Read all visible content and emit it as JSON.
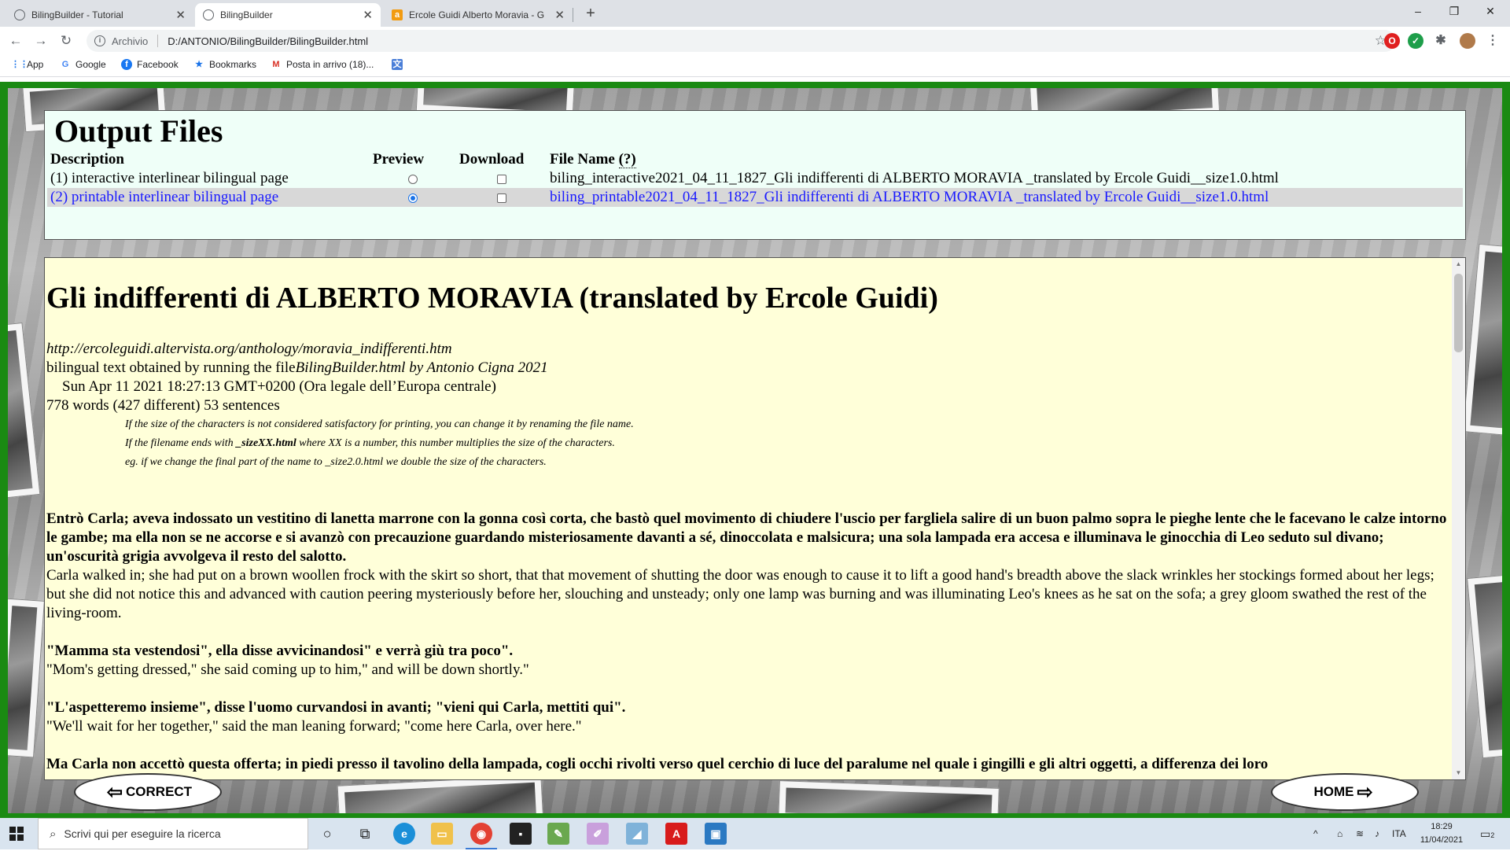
{
  "browser": {
    "tabs": [
      {
        "title": "BilingBuilder - Tutorial",
        "icon": "globe-icon",
        "active": false
      },
      {
        "title": "BilingBuilder",
        "icon": "globe-icon",
        "active": true
      },
      {
        "title": "Ercole Guidi Alberto Moravia - G",
        "icon": "amazon-icon",
        "active": false
      }
    ],
    "new_tab": "+",
    "window_controls": {
      "minimize": "–",
      "restore": "❐",
      "close": "✕"
    },
    "address": {
      "site_label": "Archivio",
      "url": "D:/ANTONIO/BilingBuilder/BilingBuilder.html"
    },
    "bookmarks": [
      {
        "label": "App",
        "icon": "apps-grid-icon"
      },
      {
        "label": "Google",
        "icon": "google-icon"
      },
      {
        "label": "Facebook",
        "icon": "facebook-icon"
      },
      {
        "label": "Bookmarks",
        "icon": "star-icon"
      },
      {
        "label": "Posta in arrivo (18)...",
        "icon": "gmail-icon"
      },
      {
        "label": "",
        "icon": "translate-icon"
      }
    ]
  },
  "output_files": {
    "title": "Output Files",
    "headers": {
      "description": "Description",
      "preview": "Preview",
      "download": "Download",
      "file_name": "File Name",
      "help": "(?)"
    },
    "rows": [
      {
        "description": "(1) interactive interlinear bilingual page",
        "preview": false,
        "download": false,
        "file_name": "biling_interactive2021_04_11_1827_Gli indifferenti di ALBERTO MORAVIA _translated by Ercole Guidi__size1.0.html"
      },
      {
        "description": "(2) printable interlinear bilingual page",
        "preview": true,
        "download": false,
        "file_name": "biling_printable2021_04_11_1827_Gli indifferenti di ALBERTO MORAVIA _translated by Ercole Guidi__size1.0.html"
      }
    ]
  },
  "document": {
    "title": "Gli indifferenti di ALBERTO MORAVIA (translated by Ercole Guidi)",
    "source_url": "http://ercoleguidi.altervista.org/anthology/moravia_indifferenti.htm",
    "obtained_prefix": "bilingual text obtained by running the file",
    "obtained_suffix": "BilingBuilder.html by Antonio Cigna 2021",
    "date": "Sun Apr 11 2021 18:27:13 GMT+0200 (Ora legale dell’Europa centrale)",
    "stats": "778 words (427 different) 53 sentences",
    "notes": [
      "If the size of the characters is not considered satisfactory for printing, you can change it by renaming the file name.",
      "eg. if we change the final part of the name to _size2.0.html we double the size of the characters."
    ],
    "note2_prefix": "If the filename ends with ",
    "note2_bold": "_sizeXX.html",
    "note2_suffix": " where XX is a number, this number multiplies the size of the characters.",
    "paragraphs": [
      {
        "it": "Entrò Carla; aveva indossato un vestitino di lanetta marrone con la gonna così corta, che bastò quel movimento di chiudere l'uscio per fargliela salire di un buon palmo sopra le pieghe lente che le facevano le calze intorno le gambe; ma ella non se ne accorse e si avanzò con precauzione guardando misteriosamente davanti a sé, dinoccolata e malsicura; una sola lampada era accesa e illuminava le ginocchia di Leo seduto sul divano; un'oscurità grigia avvolgeva il resto del salotto.",
        "en": "Carla walked in; she had put on a brown woollen frock with the skirt so short, that that movement of shutting the door was enough to cause it to lift a good hand's breadth above the slack wrinkles her stockings formed about her legs; but she did not notice this and advanced with caution peering mysteriously before her, slouching and unsteady; only one lamp was burning and was illuminating Leo's knees as he sat on the sofa; a grey gloom swathed the rest of the living-room."
      },
      {
        "it": "\"Mamma sta vestendosi\", ella disse avvicinandosi\" e verrà giù tra poco\".",
        "en": "\"Mom's getting dressed,\" she said coming up to him,\" and will be down shortly.\""
      },
      {
        "it": "\"L'aspetteremo insieme\", disse l'uomo curvandosi in avanti; \"vieni qui Carla, mettiti qui\".",
        "en": "\"We'll wait for her together,\" said the man leaning forward; \"come here Carla, over here.\""
      },
      {
        "it": "Ma Carla non accettò questa offerta; in piedi presso il tavolino della lampada, cogli occhi rivolti verso quel cerchio di luce del paralume nel quale i gingilli e gli altri oggetti, a differenza dei loro",
        "en": ""
      }
    ]
  },
  "nav": {
    "correct": "CORRECT",
    "home": "HOME"
  },
  "taskbar": {
    "search_placeholder": "Scrivi qui per eseguire la ricerca",
    "language": "ITA",
    "time": "18:29",
    "date": "11/04/2021",
    "notifications": "2"
  }
}
